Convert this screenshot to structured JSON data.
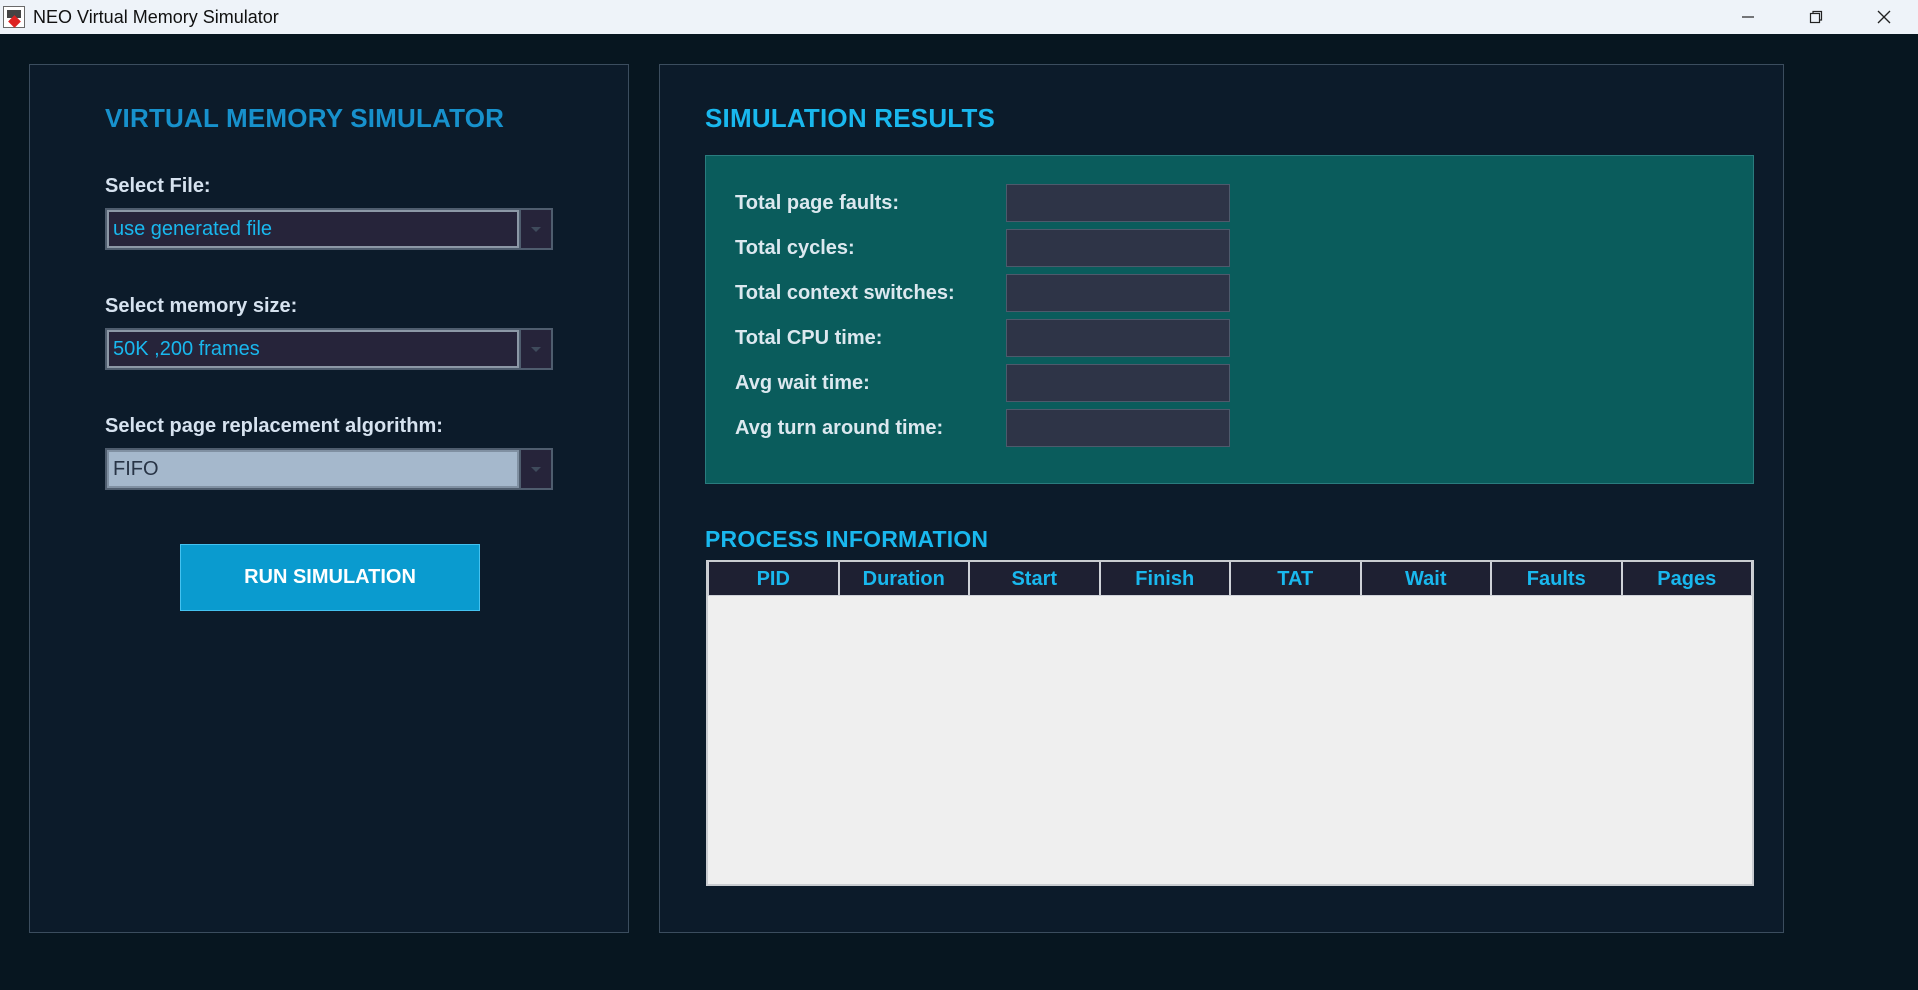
{
  "window": {
    "title": "NEO Virtual Memory Simulator"
  },
  "left": {
    "heading": "VIRTUAL MEMORY SIMULATOR",
    "file": {
      "label": "Select File:",
      "value": "use generated file"
    },
    "memory": {
      "label": "Select memory size:",
      "value": "50K ,200 frames"
    },
    "algorithm": {
      "label": "Select page replacement algorithm:",
      "value": "FIFO"
    },
    "run_label": "RUN SIMULATION"
  },
  "right": {
    "results_heading": "SIMULATION RESULTS",
    "results": [
      {
        "label": "Total page faults:",
        "value": ""
      },
      {
        "label": "Total cycles:",
        "value": ""
      },
      {
        "label": "Total context switches:",
        "value": ""
      },
      {
        "label": "Total CPU time:",
        "value": ""
      },
      {
        "label": "Avg wait time:",
        "value": ""
      },
      {
        "label": "Avg turn around time:",
        "value": ""
      }
    ],
    "process_heading": "PROCESS INFORMATION",
    "columns": [
      "PID",
      "Duration",
      "Start",
      "Finish",
      "TAT",
      "Wait",
      "Faults",
      "Pages"
    ],
    "rows": []
  },
  "colors": {
    "background": "#071620",
    "panel": "#0c1b2a",
    "accent": "#19b8ee",
    "results_box": "#0a5c5c",
    "button": "#0a9bcf"
  },
  "icons": [
    "app-icon",
    "minimize-icon",
    "restore-icon",
    "close-icon",
    "chevron-down-icon"
  ]
}
